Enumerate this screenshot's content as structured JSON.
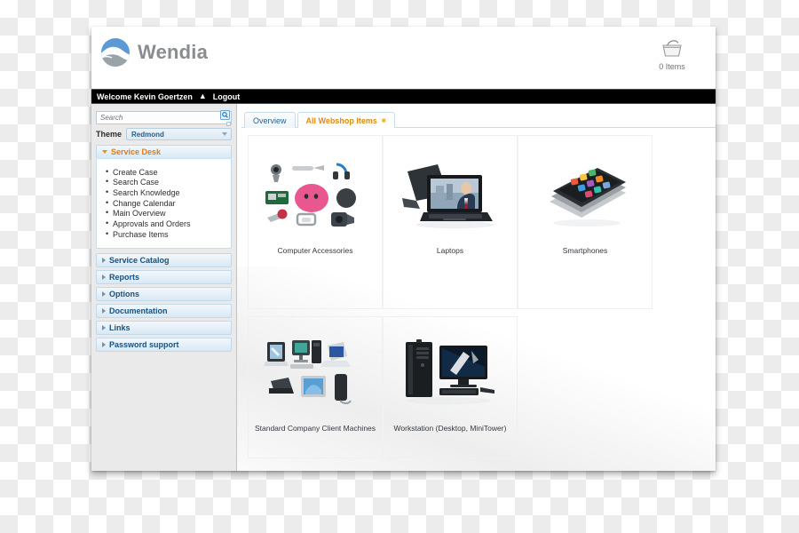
{
  "brand": {
    "name": "Wendia",
    "logo_icon": "wendia-wave-logo",
    "logo_color": "#5b9bd5"
  },
  "cart": {
    "icon": "shopping-basket-icon",
    "count_label": "0 Items"
  },
  "welcome_bar": {
    "greeting": "Welcome Kevin Goertzen",
    "caret_icon": "caret-up-icon",
    "logout_label": "Logout",
    "background": "#000000"
  },
  "sidebar": {
    "search": {
      "placeholder": "Search",
      "value": "",
      "icon": "search-icon"
    },
    "theme": {
      "label": "Theme",
      "selected": "Redmond",
      "arrow_icon": "chevron-down-icon"
    },
    "accordion": [
      {
        "title": "Service Desk",
        "expanded": true,
        "items": [
          "Create Case",
          "Search Case",
          "Search Knowledge",
          "Change Calendar",
          "Main Overview",
          "Approvals and Orders",
          "Purchase Items"
        ]
      },
      {
        "title": "Service Catalog",
        "expanded": false,
        "items": []
      },
      {
        "title": "Reports",
        "expanded": false,
        "items": []
      },
      {
        "title": "Options",
        "expanded": false,
        "items": []
      },
      {
        "title": "Documentation",
        "expanded": false,
        "items": []
      },
      {
        "title": "Links",
        "expanded": false,
        "items": []
      },
      {
        "title": "Password support",
        "expanded": false,
        "items": []
      }
    ],
    "active_header_color": "#e07b12",
    "header_color": "#18507f"
  },
  "tabs": [
    {
      "label": "Overview",
      "active": false,
      "closable": false
    },
    {
      "label": "All Webshop Items",
      "active": true,
      "closable": true,
      "close_icon": "close-icon"
    }
  ],
  "products": {
    "row1": [
      {
        "label": "Computer Accessories",
        "art": "computer-accessories-image"
      },
      {
        "label": "Laptops",
        "art": "laptop-image"
      },
      {
        "label": "Smartphones",
        "art": "smartphones-image"
      }
    ],
    "row2": [
      {
        "label": "Standard Company Client Machines",
        "art": "client-machines-image"
      },
      {
        "label": "Workstation (Desktop, MiniTower)",
        "art": "workstation-image"
      }
    ]
  }
}
